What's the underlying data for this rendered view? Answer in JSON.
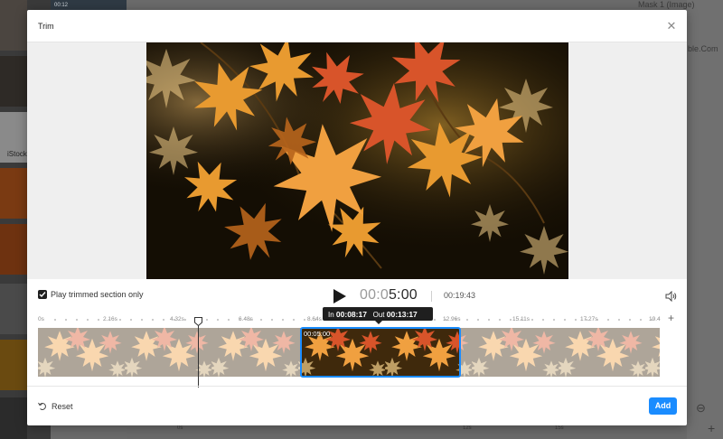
{
  "background": {
    "top_time": "00:12",
    "right_panel_label": "Mask 1 (Image)",
    "right_panel_text": "ble.Com",
    "sidebar_badge": "iStock",
    "timeline_ticks": [
      "0s",
      "12s",
      "15s"
    ]
  },
  "modal": {
    "title": "Trim",
    "close_icon": "close-icon"
  },
  "controls": {
    "play_trimmed_label": "Play trimmed section only",
    "play_trimmed_checked": true,
    "timecode_dim": "00:0",
    "timecode_strong": "5:00",
    "duration": "00:19:43"
  },
  "ruler": {
    "ticks": [
      "0s",
      "2.16s",
      "4.32s",
      "6.48s",
      "8.64s",
      "12.96s",
      "15.11s",
      "17.27s",
      "19.4"
    ]
  },
  "selection": {
    "start_label": "00:05:00",
    "in_label": "In",
    "in_value": "00:08:17",
    "out_label": "Out",
    "out_value": "00:13:17"
  },
  "footer": {
    "reset_label": "Reset",
    "add_label": "Add"
  },
  "colors": {
    "accent": "#1a8cff",
    "tooltip_bg": "#1f1f1f"
  }
}
